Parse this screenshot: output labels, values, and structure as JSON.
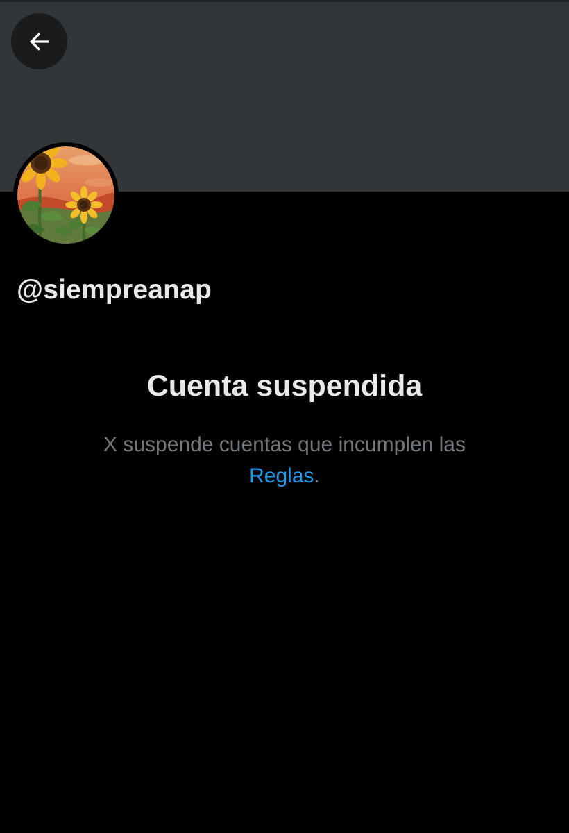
{
  "header": {
    "back_icon": "arrow-left-icon"
  },
  "profile": {
    "avatar_description": "sunflowers",
    "handle": "@siempreanap"
  },
  "suspension": {
    "title": "Cuenta suspendida",
    "message": "X suspende cuentas que incumplen las",
    "link_label": "Reglas",
    "trailing": "."
  },
  "colors": {
    "background": "#000000",
    "banner": "#333639",
    "text_primary": "#e7e9ea",
    "text_secondary": "#71767b",
    "link": "#1d9bf0"
  }
}
